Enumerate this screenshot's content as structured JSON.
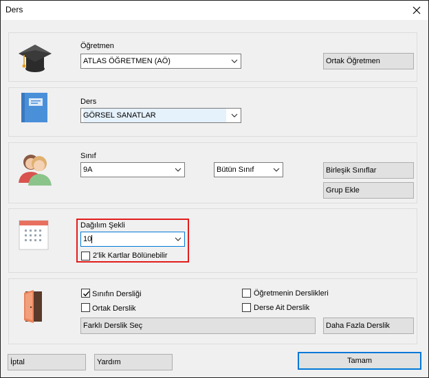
{
  "window": {
    "title": "Ders"
  },
  "teacher": {
    "label": "Öğretmen",
    "selected": "ATLAS ÖĞRETMEN (AÖ)",
    "co_teacher_button": "Ortak Öğretmen"
  },
  "lesson": {
    "label": "Ders",
    "selected": "GÖRSEL SANATLAR"
  },
  "class": {
    "label": "Sınıf",
    "selected": "9A",
    "scope_selected": "Bütün Sınıf",
    "combined_classes_button": "Birleşik Sınıflar",
    "add_group_button": "Grup Ekle"
  },
  "distribution": {
    "label": "Dağılım Şekli",
    "value": "10",
    "split_checkbox_label": "2'lik Kartlar Bölünebilir",
    "split_checked": false
  },
  "classroom": {
    "class_room_label": "Sınıfın Dersliği",
    "class_room_checked": true,
    "teacher_rooms_label": "Öğretmenin Derslikleri",
    "teacher_rooms_checked": false,
    "shared_room_label": "Ortak Derslik",
    "shared_room_checked": false,
    "lesson_room_label": "Derse Ait Derslik",
    "lesson_room_checked": false,
    "choose_other_button": "Farklı Derslik Seç",
    "more_rooms_button": "Daha Fazla Derslik"
  },
  "footer": {
    "cancel_button": "İptal",
    "help_button": "Yardım",
    "ok_button": "Tamam"
  },
  "colors": {
    "highlight_border": "#e21b1b",
    "primary_border": "#0078d7",
    "book_blue": "#4a90d9"
  }
}
